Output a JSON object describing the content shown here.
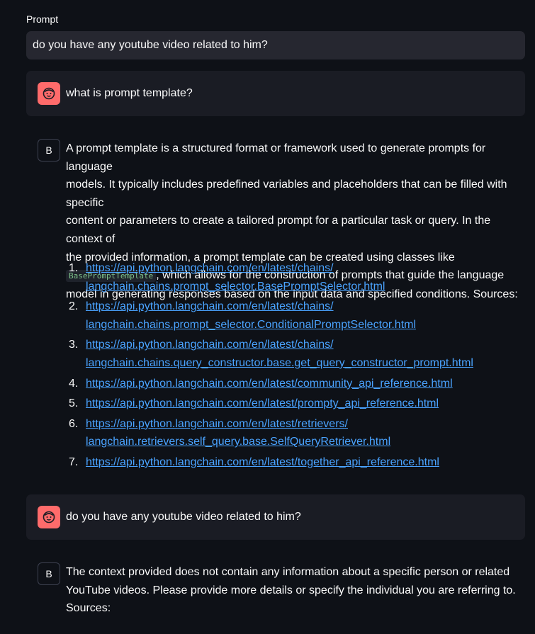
{
  "prompt": {
    "label": "Prompt",
    "value": "do you have any youtube video related to him?"
  },
  "messages": [
    {
      "role": "user",
      "avatar_icon": "face-icon",
      "text": "what is prompt template?"
    },
    {
      "role": "assistant",
      "avatar_label": "B",
      "lines": [
        "A prompt template is a structured format or framework used to generate prompts for language",
        "models. It typically includes predefined variables and placeholders that can be filled with specific",
        "content or parameters to create a tailored prompt for a particular task or query. In the context of",
        "the provided information, a prompt template can be created using classes like"
      ],
      "code": "BasePromptTemplate",
      "after_code": ", which allows for the construction of prompts that guide the language",
      "last_line": "model in generating responses based on the input data and specified conditions. Sources:",
      "sources": [
        {
          "num": "1.",
          "line1": "https://api.python.langchain.com/en/latest/chains/",
          "line2": "langchain.chains.prompt_selector.BasePromptSelector.html"
        },
        {
          "num": "2.",
          "line1": "https://api.python.langchain.com/en/latest/chains/",
          "line2": "langchain.chains.prompt_selector.ConditionalPromptSelector.html"
        },
        {
          "num": "3.",
          "line1": "https://api.python.langchain.com/en/latest/chains/",
          "line2": "langchain.chains.query_constructor.base.get_query_constructor_prompt.html"
        },
        {
          "num": "4.",
          "line1": "https://api.python.langchain.com/en/latest/community_api_reference.html",
          "line2": ""
        },
        {
          "num": "5.",
          "line1": "https://api.python.langchain.com/en/latest/prompty_api_reference.html",
          "line2": ""
        },
        {
          "num": "6.",
          "line1": "https://api.python.langchain.com/en/latest/retrievers/",
          "line2": "langchain.retrievers.self_query.base.SelfQueryRetriever.html"
        },
        {
          "num": "7.",
          "line1": "https://api.python.langchain.com/en/latest/together_api_reference.html",
          "line2": ""
        }
      ]
    },
    {
      "role": "user",
      "avatar_icon": "face-icon",
      "text": "do you have any youtube video related to him?"
    },
    {
      "role": "assistant",
      "avatar_label": "B",
      "lines": [
        "The context provided does not contain any information about a specific person or related",
        "YouTube videos. Please provide more details or specify the individual you are referring to.",
        "Sources:"
      ]
    }
  ],
  "colors": {
    "background": "#0e1117",
    "input_bg": "#262730",
    "user_msg_bg": "#1a1c24",
    "user_avatar": "#ff6b6b",
    "link": "#4aa3ff",
    "code_text": "#7ec28a"
  }
}
